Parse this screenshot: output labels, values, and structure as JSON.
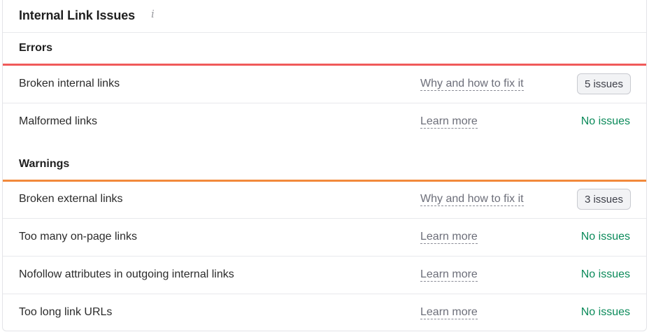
{
  "header": {
    "title": "Internal Link Issues",
    "info_icon": "info-icon"
  },
  "errors": {
    "title": "Errors",
    "bar_color": "#f05a5a",
    "rows": [
      {
        "label": "Broken internal links",
        "link": "Why and how to fix it",
        "status": "5 issues",
        "status_type": "badge"
      },
      {
        "label": "Malformed links",
        "link": "Learn more",
        "status": "No issues",
        "status_type": "ok"
      }
    ]
  },
  "warnings": {
    "title": "Warnings",
    "bar_color": "#f2893c",
    "rows": [
      {
        "label": "Broken external links",
        "link": "Why and how to fix it",
        "status": "3 issues",
        "status_type": "badge"
      },
      {
        "label": "Too many on-page links",
        "link": "Learn more",
        "status": "No issues",
        "status_type": "ok"
      },
      {
        "label": "Nofollow attributes in outgoing internal links",
        "link": "Learn more",
        "status": "No issues",
        "status_type": "ok"
      },
      {
        "label": "Too long link URLs",
        "link": "Learn more",
        "status": "No issues",
        "status_type": "ok"
      }
    ]
  },
  "colors": {
    "ok_text": "#0b8a5a",
    "link_text": "#6c6e79"
  }
}
